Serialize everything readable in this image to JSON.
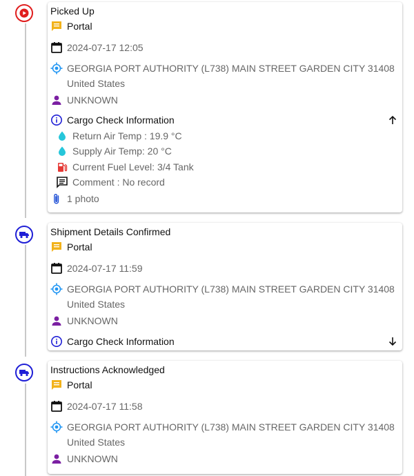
{
  "events": [
    {
      "title": "Picked Up",
      "source": "Portal",
      "datetime": "2024-07-17 12:05",
      "address_line1": "GEORGIA PORT AUTHORITY (L738) MAIN STREET GARDEN CITY 31408",
      "address_line2": "United States",
      "user": "UNKNOWN",
      "cargo_label": "Cargo Check Information",
      "return_air": "Return Air Temp : 19.9 °C",
      "supply_air": "Supply Air Temp: 20 °C",
      "fuel": "Current Fuel Level: 3/4 Tank",
      "comment": "Comment : No record",
      "photos": "1 photo"
    },
    {
      "title": "Shipment Details Confirmed",
      "source": "Portal",
      "datetime": "2024-07-17 11:59",
      "address_line1": "GEORGIA PORT AUTHORITY (L738) MAIN STREET GARDEN CITY 31408",
      "address_line2": "United States",
      "user": "UNKNOWN",
      "cargo_label": "Cargo Check Information"
    },
    {
      "title": "Instructions Acknowledged",
      "source": "Portal",
      "datetime": "2024-07-17 11:58",
      "address_line1": "GEORGIA PORT AUTHORITY (L738) MAIN STREET GARDEN CITY 31408",
      "address_line2": "United States",
      "user": "UNKNOWN"
    }
  ],
  "colors": {
    "status_red": "#e01d1d",
    "status_blue": "#1f1fd6",
    "chat_icon": "#f2b21b",
    "location_icon": "#2196f3",
    "user_icon": "#7b1fa2",
    "info_icon": "#1f1fd6",
    "drop_icon": "#26c6da",
    "fuel_icon": "#e53935",
    "attach_icon": "#1f4fd6"
  }
}
